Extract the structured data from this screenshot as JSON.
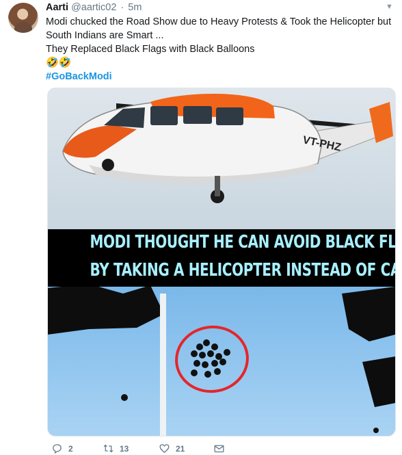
{
  "tweet": {
    "author_name": "Aarti",
    "author_handle": "@aartic02",
    "separator": "·",
    "time": "5m",
    "text_line1": "Modi chucked the Road Show due to Heavy Protests & Took the Helicopter but",
    "text_line2": "South Indians are Smart ...",
    "text_line3": "They Replaced Black Flags with Black Balloons",
    "emoji": "🤣🤣",
    "hashtag": "#GoBackModi"
  },
  "image": {
    "helicopter_reg": "VT-PHZ",
    "caption_line1": "MODI THOUGHT HE CAN AVOID BLACK FLAGS",
    "caption_line2": "BY TAKING A HELICOPTER INSTEAD OF CAR"
  },
  "actions": {
    "reply_count": "2",
    "retweet_count": "13",
    "like_count": "21"
  },
  "colors": {
    "accent": "#1b95e0",
    "muted": "#657786",
    "caption_text": "#a8f0ff",
    "circle": "#e4262b"
  },
  "icons": [
    "chevron-down-icon",
    "reply-icon",
    "retweet-icon",
    "like-icon",
    "dm-icon"
  ]
}
